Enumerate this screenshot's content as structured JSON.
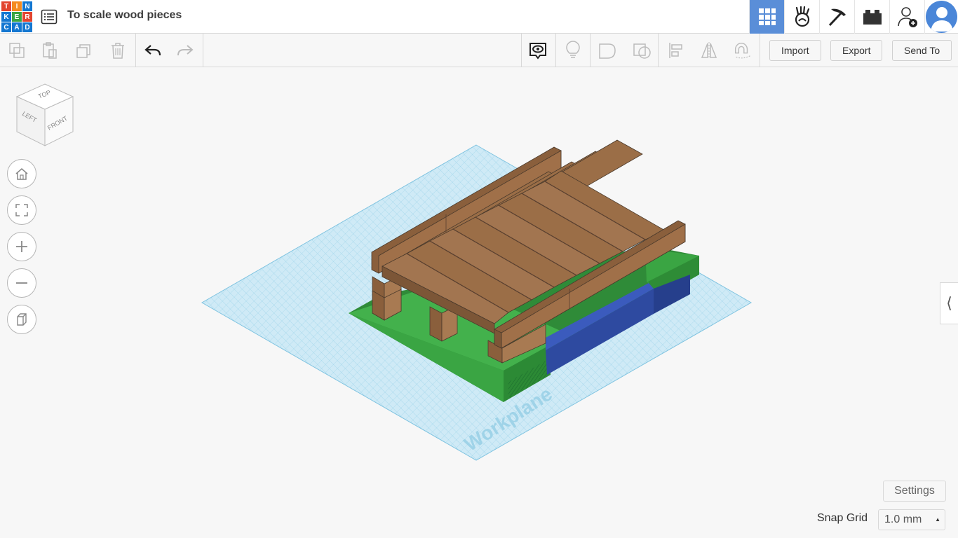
{
  "app": {
    "logo_letters": [
      "T",
      "I",
      "N",
      "K",
      "E",
      "R",
      "C",
      "A",
      "D"
    ],
    "title": "To scale wood pieces"
  },
  "header_icons": [
    "3d-design-grid-icon",
    "codeblocks-icon",
    "minecraft-pickaxe-icon",
    "lego-brick-icon",
    "add-user-icon",
    "user-avatar-icon"
  ],
  "toolbar": {
    "import_label": "Import",
    "export_label": "Export",
    "send_to_label": "Send To"
  },
  "viewcube": {
    "top": "TOP",
    "left": "LEFT",
    "front": "FRONT"
  },
  "workplane_label": "Workplane",
  "settings_label": "Settings",
  "snap": {
    "label": "Snap Grid",
    "value": "1.0 mm"
  },
  "colors": {
    "accent": "#5a8ed8",
    "workplane": "#bde3f2",
    "wood": "#9b6e47",
    "green": "#3aa543",
    "blue": "#2e4aa0"
  }
}
